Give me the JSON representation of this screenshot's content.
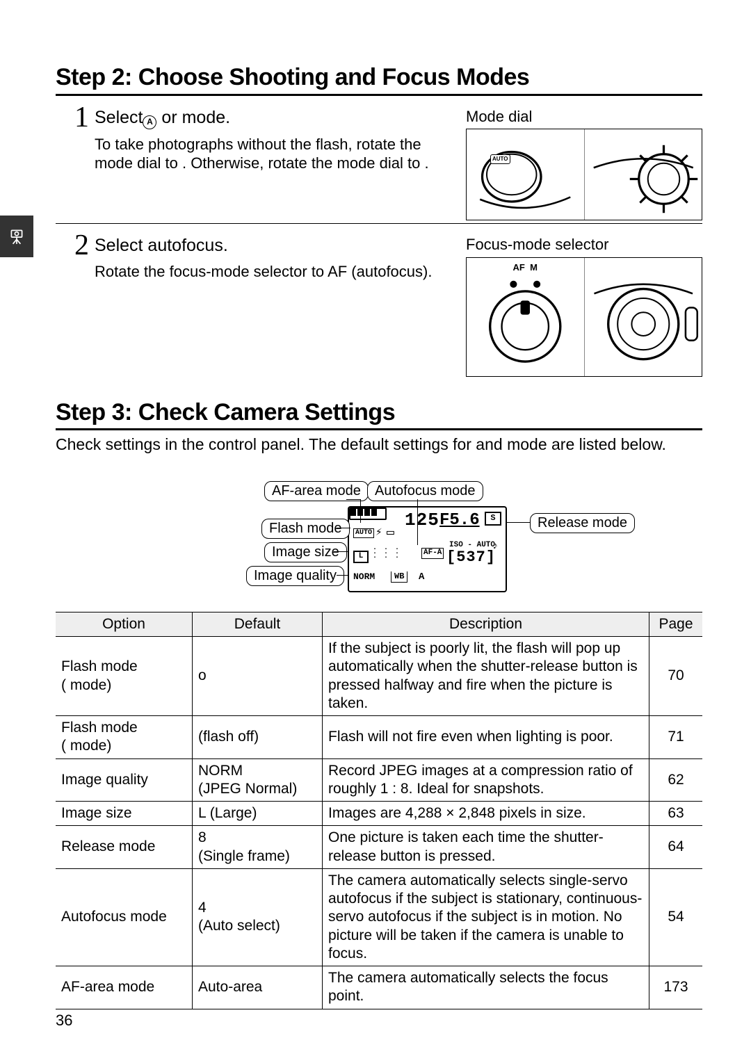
{
  "page_number": "36",
  "side_tab_icon": "camera-on-tripod",
  "step2": {
    "title": "Step 2: Choose Shooting and Focus Modes",
    "sub1": {
      "num": "1",
      "head_before": "Select",
      "head_after": " or      mode.",
      "caption": "Mode dial",
      "desc": "To take photographs without the flash, rotate the mode dial to     . Otherwise, rotate the mode dial to   ."
    },
    "sub2": {
      "num": "2",
      "head": "Select autofocus.",
      "caption": "Focus-mode selector",
      "desc": "Rotate the focus-mode selector to AF (autofocus).",
      "af_label": "AF",
      "m_label": "M"
    }
  },
  "step3": {
    "title": "Step 3: Check Camera Settings",
    "intro": "Check settings in the control panel.  The default settings for     and      mode are listed below.",
    "callouts": {
      "af_area": "AF-area mode",
      "autofocus": "Autofocus mode",
      "release": "Release mode",
      "flash": "Flash mode",
      "size": "Image size",
      "quality": "Image quality"
    },
    "panel": {
      "shutter": "125",
      "fnumber": "F5.6",
      "s": "S",
      "auto": "AUTO",
      "afa": "AF-A",
      "iso": "ISO - AUTO",
      "count": "537",
      "l": "L",
      "norm": "NORM",
      "wb": "WB",
      "a": "A"
    }
  },
  "table": {
    "headers": {
      "option": "Option",
      "default": "Default",
      "description": "Description",
      "page": "Page"
    },
    "rows": [
      {
        "option": "Flash mode\n(   mode)",
        "default": "o",
        "description": "If the subject is poorly lit, the flash will pop up automatically when the shutter-release button is pressed halfway and fire when the picture is taken.",
        "page": "70"
      },
      {
        "option": "Flash mode\n(    mode)",
        "default": "(flash off)",
        "description": "Flash will not fire even when lighting is poor.",
        "page": "71"
      },
      {
        "option": "Image quality",
        "default": "NORM\n(JPEG Normal)",
        "description": "Record JPEG images at a compression ratio of roughly 1 : 8.  Ideal for snapshots.",
        "page": "62"
      },
      {
        "option": "Image size",
        "default": "L (Large)",
        "description": "Images are 4,288 × 2,848 pixels in size.",
        "page": "63"
      },
      {
        "option": "Release mode",
        "default": "8\n(Single frame)",
        "description": "One picture is taken each time the shutter-release button is pressed.",
        "page": "64"
      },
      {
        "option": "Autofocus mode",
        "default": "4\n(Auto select)",
        "description": "The camera automatically selects single-servo autofocus if the subject is stationary, continuous-servo autofocus if the subject is in motion.  No picture will be taken if the camera is unable to focus.",
        "page": "54"
      },
      {
        "option": "AF-area mode",
        "default": "Auto-area",
        "description": "The camera automatically selects the focus point.",
        "page": "173"
      }
    ]
  },
  "chart_data": {
    "type": "table",
    "title": "Default camera settings",
    "columns": [
      "Option",
      "Default",
      "Description",
      "Page"
    ],
    "rows": [
      [
        "Flash mode (auto mode)",
        "o",
        "If the subject is poorly lit, the flash will pop up automatically when the shutter-release button is pressed halfway and fire when the picture is taken.",
        70
      ],
      [
        "Flash mode (flash-off mode)",
        "(flash off)",
        "Flash will not fire even when lighting is poor.",
        71
      ],
      [
        "Image quality",
        "NORM (JPEG Normal)",
        "Record JPEG images at a compression ratio of roughly 1 : 8. Ideal for snapshots.",
        62
      ],
      [
        "Image size",
        "L (Large)",
        "Images are 4,288 × 2,848 pixels in size.",
        63
      ],
      [
        "Release mode",
        "8 (Single frame)",
        "One picture is taken each time the shutter-release button is pressed.",
        64
      ],
      [
        "Autofocus mode",
        "4 (Auto select)",
        "The camera automatically selects single-servo autofocus if the subject is stationary, continuous-servo autofocus if the subject is in motion. No picture will be taken if the camera is unable to focus.",
        54
      ],
      [
        "AF-area mode",
        "Auto-area",
        "The camera automatically selects the focus point.",
        173
      ]
    ]
  }
}
